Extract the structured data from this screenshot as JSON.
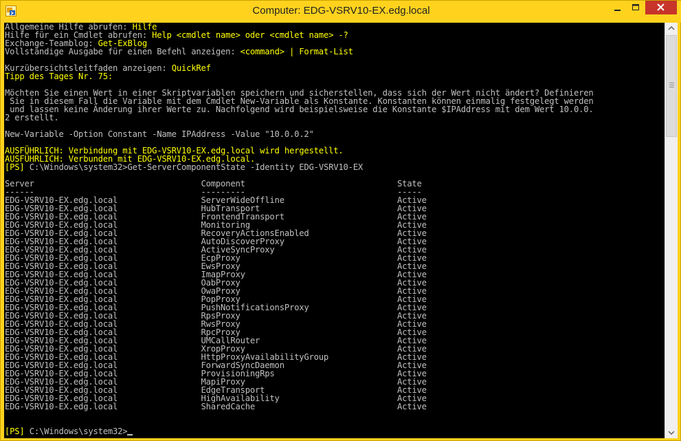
{
  "window": {
    "title": "Computer: EDG-VSRV10-EX.edg.local",
    "icon": "powershell-exchange-icon",
    "buttons": [
      "minimize-icon",
      "maximize-icon",
      "close-icon"
    ]
  },
  "colors": {
    "titlebar": "#ffd21e",
    "console_bg": "#000000",
    "yellow_text": "#ffff00",
    "gray_text": "#c0c0c0",
    "close_button": "#c7342a"
  },
  "console": {
    "intro": [
      {
        "label": "Allgemeine Hilfe abrufen: ",
        "value": "Hilfe"
      },
      {
        "label": "Hilfe für ein Cmdlet abrufen: ",
        "value": "Help <cmdlet name> oder <cmdlet name> -?"
      },
      {
        "label": "Exchange-Teamblog: ",
        "value": "Get-ExBlog"
      },
      {
        "label": "Vollständige Ausgabe für einen Befehl anzeigen: ",
        "value": "<command> | Format-List"
      },
      {
        "label": "Kurzübersichtsleitfaden anzeigen: ",
        "value": "QuickRef"
      }
    ],
    "tip_header": "Tipp des Tages Nr. 75:",
    "tip_lines": [
      "Möchten Sie einen Wert in einer Skriptvariablen speichern und sicherstellen, dass sich der Wert nicht ändert? Definieren",
      " Sie in diesem Fall die Variable mit dem Cmdlet New-Variable als Konstante. Konstanten können einmalig festgelegt werden",
      " und lassen keine Änderung ihrer Werte zu. Nachfolgend wird beispielsweise die Konstante $IPAddress mit dem Wert 10.0.0.",
      "2 erstellt."
    ],
    "tip_example": "New-Variable -Option Constant -Name IPAddress -Value \"10.0.0.2\"",
    "verbose_lines": [
      "AUSFÜHRLICH: Verbindung mit EDG-VSRV10-EX.edg.local wird hergestellt.",
      "AUSFÜHRLICH: Verbunden mit EDG-VSRV10-EX.edg.local."
    ],
    "prompt_tag": "[PS]",
    "prompt_path": " C:\\Windows\\system32>",
    "command": "Get-ServerComponentState -Identity EDG-VSRV10-EX",
    "table_headers": [
      "Server",
      "Component",
      "State"
    ],
    "table_underlines": [
      "------",
      "---------",
      "-----"
    ],
    "rows": [
      {
        "server": "EDG-VSRV10-EX.edg.local",
        "component": "ServerWideOffline",
        "state": "Active"
      },
      {
        "server": "EDG-VSRV10-EX.edg.local",
        "component": "HubTransport",
        "state": "Active"
      },
      {
        "server": "EDG-VSRV10-EX.edg.local",
        "component": "FrontendTransport",
        "state": "Active"
      },
      {
        "server": "EDG-VSRV10-EX.edg.local",
        "component": "Monitoring",
        "state": "Active"
      },
      {
        "server": "EDG-VSRV10-EX.edg.local",
        "component": "RecoveryActionsEnabled",
        "state": "Active"
      },
      {
        "server": "EDG-VSRV10-EX.edg.local",
        "component": "AutoDiscoverProxy",
        "state": "Active"
      },
      {
        "server": "EDG-VSRV10-EX.edg.local",
        "component": "ActiveSyncProxy",
        "state": "Active"
      },
      {
        "server": "EDG-VSRV10-EX.edg.local",
        "component": "EcpProxy",
        "state": "Active"
      },
      {
        "server": "EDG-VSRV10-EX.edg.local",
        "component": "EwsProxy",
        "state": "Active"
      },
      {
        "server": "EDG-VSRV10-EX.edg.local",
        "component": "ImapProxy",
        "state": "Active"
      },
      {
        "server": "EDG-VSRV10-EX.edg.local",
        "component": "OabProxy",
        "state": "Active"
      },
      {
        "server": "EDG-VSRV10-EX.edg.local",
        "component": "OwaProxy",
        "state": "Active"
      },
      {
        "server": "EDG-VSRV10-EX.edg.local",
        "component": "PopProxy",
        "state": "Active"
      },
      {
        "server": "EDG-VSRV10-EX.edg.local",
        "component": "PushNotificationsProxy",
        "state": "Active"
      },
      {
        "server": "EDG-VSRV10-EX.edg.local",
        "component": "RpsProxy",
        "state": "Active"
      },
      {
        "server": "EDG-VSRV10-EX.edg.local",
        "component": "RwsProxy",
        "state": "Active"
      },
      {
        "server": "EDG-VSRV10-EX.edg.local",
        "component": "RpcProxy",
        "state": "Active"
      },
      {
        "server": "EDG-VSRV10-EX.edg.local",
        "component": "UMCallRouter",
        "state": "Active"
      },
      {
        "server": "EDG-VSRV10-EX.edg.local",
        "component": "XropProxy",
        "state": "Active"
      },
      {
        "server": "EDG-VSRV10-EX.edg.local",
        "component": "HttpProxyAvailabilityGroup",
        "state": "Active"
      },
      {
        "server": "EDG-VSRV10-EX.edg.local",
        "component": "ForwardSyncDaemon",
        "state": "Active"
      },
      {
        "server": "EDG-VSRV10-EX.edg.local",
        "component": "ProvisioningRps",
        "state": "Active"
      },
      {
        "server": "EDG-VSRV10-EX.edg.local",
        "component": "MapiProxy",
        "state": "Active"
      },
      {
        "server": "EDG-VSRV10-EX.edg.local",
        "component": "EdgeTransport",
        "state": "Active"
      },
      {
        "server": "EDG-VSRV10-EX.edg.local",
        "component": "HighAvailability",
        "state": "Active"
      },
      {
        "server": "EDG-VSRV10-EX.edg.local",
        "component": "SharedCache",
        "state": "Active"
      }
    ]
  }
}
